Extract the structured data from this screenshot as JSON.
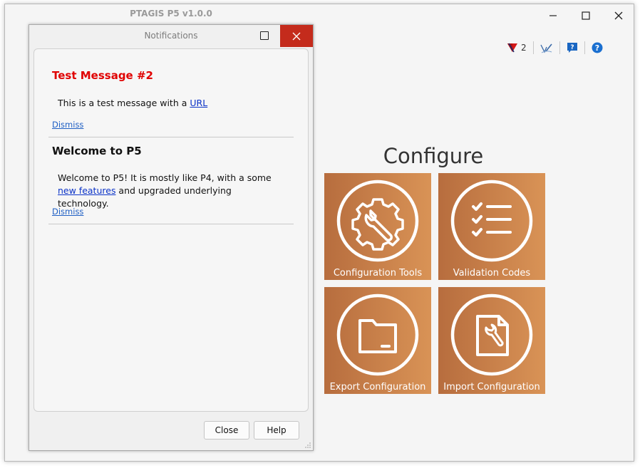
{
  "app": {
    "title": "PTAGIS P5 v1.0.0"
  },
  "toolbar": {
    "notification_count": "2"
  },
  "configure": {
    "heading": "Configure",
    "tiles": [
      {
        "label": "Configuration Tools",
        "icon": "gear-wrench-icon"
      },
      {
        "label": "Validation Codes",
        "icon": "checklist-icon"
      },
      {
        "label": "Export Configuration",
        "icon": "folder-icon"
      },
      {
        "label": "Import Configuration",
        "icon": "document-wrench-icon"
      }
    ],
    "tile_color_start": "#b76d3e",
    "tile_color_end": "#d99356"
  },
  "notifications": {
    "title": "Notifications",
    "messages": [
      {
        "title": "Test Message #2",
        "title_color": "#e00000",
        "body_prefix": "This is a test message with a ",
        "link_text": "URL",
        "dismiss": "Dismiss"
      },
      {
        "title": "Welcome to P5",
        "body_prefix": "Welcome to P5! It is mostly like P4, with a some ",
        "link_text": "new features",
        "body_suffix": " and upgraded underlying technology.",
        "dismiss": "Dismiss"
      }
    ],
    "close_label": "Close",
    "help_label": "Help"
  },
  "colors": {
    "close_button_red": "#c42b1c",
    "link_blue": "#0b33c8"
  }
}
